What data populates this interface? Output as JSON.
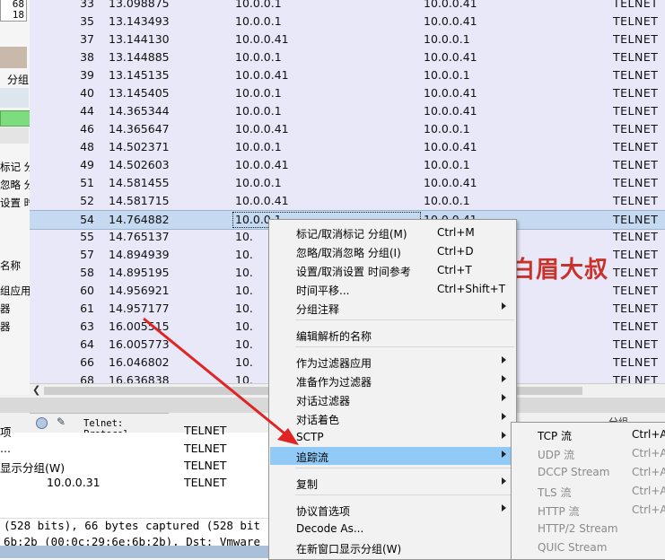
{
  "left_window": {
    "numbers": [
      "68",
      "18"
    ],
    "tab_label": "分组",
    "labels": [
      "标记 分",
      "忽略 分",
      "设置 时",
      "",
      "名称",
      "组应用",
      "器",
      "器"
    ]
  },
  "packets": [
    {
      "no": "33",
      "time": "13.098875",
      "src": "10.0.0.1",
      "dst": "10.0.0.41",
      "proto": "TELNET"
    },
    {
      "no": "35",
      "time": "13.143493",
      "src": "10.0.0.1",
      "dst": "10.0.0.41",
      "proto": "TELNET"
    },
    {
      "no": "37",
      "time": "13.144130",
      "src": "10.0.0.41",
      "dst": "10.0.0.1",
      "proto": "TELNET"
    },
    {
      "no": "38",
      "time": "13.144885",
      "src": "10.0.0.1",
      "dst": "10.0.0.41",
      "proto": "TELNET"
    },
    {
      "no": "39",
      "time": "13.145135",
      "src": "10.0.0.41",
      "dst": "10.0.0.1",
      "proto": "TELNET"
    },
    {
      "no": "40",
      "time": "13.145405",
      "src": "10.0.0.1",
      "dst": "10.0.0.41",
      "proto": "TELNET"
    },
    {
      "no": "44",
      "time": "14.365344",
      "src": "10.0.0.1",
      "dst": "10.0.0.41",
      "proto": "TELNET"
    },
    {
      "no": "46",
      "time": "14.365647",
      "src": "10.0.0.41",
      "dst": "10.0.0.1",
      "proto": "TELNET"
    },
    {
      "no": "48",
      "time": "14.502371",
      "src": "10.0.0.1",
      "dst": "10.0.0.41",
      "proto": "TELNET"
    },
    {
      "no": "49",
      "time": "14.502603",
      "src": "10.0.0.41",
      "dst": "10.0.0.1",
      "proto": "TELNET"
    },
    {
      "no": "51",
      "time": "14.581455",
      "src": "10.0.0.1",
      "dst": "10.0.0.41",
      "proto": "TELNET"
    },
    {
      "no": "52",
      "time": "14.581715",
      "src": "10.0.0.41",
      "dst": "10.0.0.1",
      "proto": "TELNET"
    },
    {
      "no": "54",
      "time": "14.764882",
      "src": "10.0.0.1",
      "dst": "10.0.0.41",
      "proto": "TELNET"
    },
    {
      "no": "55",
      "time": "14.765137",
      "src": "10.",
      "dst": "",
      "proto": "TELNET"
    },
    {
      "no": "57",
      "time": "14.894939",
      "src": "10.",
      "dst": "",
      "proto": "TELNET"
    },
    {
      "no": "58",
      "time": "14.895195",
      "src": "10.",
      "dst": "",
      "proto": "TELNET"
    },
    {
      "no": "60",
      "time": "14.956921",
      "src": "10.",
      "dst": "",
      "proto": "TELNET"
    },
    {
      "no": "61",
      "time": "14.957177",
      "src": "10.",
      "dst": "",
      "proto": "TELNET"
    },
    {
      "no": "63",
      "time": "16.005515",
      "src": "10.",
      "dst": "",
      "proto": "TELNET"
    },
    {
      "no": "64",
      "time": "16.005773",
      "src": "10.",
      "dst": "",
      "proto": "TELNET"
    },
    {
      "no": "66",
      "time": "16.046802",
      "src": "10.",
      "dst": "",
      "proto": "TELNET"
    },
    {
      "no": "68",
      "time": "16.636838",
      "src": "10.",
      "dst": "",
      "proto": "TELNET"
    }
  ],
  "status": {
    "protocol_text": "Telnet: Protocol",
    "right_text": "分组"
  },
  "lower_pane": {
    "items": [
      "TELNET",
      "TELNET",
      "TELNET",
      "TELNET"
    ],
    "left_texts": [
      "项",
      "...",
      "显示分组(W)"
    ],
    "address": "10.0.0.31"
  },
  "details": {
    "line1": "(528 bits), 66 bytes captured (528 bit",
    "line2": "6b:2b (00:0c:29:6e:6b:2b), Dst: Vmware"
  },
  "watermark": "白眉大叔",
  "context_menu": {
    "items": [
      {
        "label": "标记/取消标记 分组(M)",
        "shortcut": "Ctrl+M",
        "submenu": false
      },
      {
        "label": "忽略/取消忽略 分组(I)",
        "shortcut": "Ctrl+D",
        "submenu": false
      },
      {
        "label": "设置/取消设置 时间参考",
        "shortcut": "Ctrl+T",
        "submenu": false
      },
      {
        "label": "时间平移...",
        "shortcut": "Ctrl+Shift+T",
        "submenu": false
      },
      {
        "label": "分组注释",
        "shortcut": "",
        "submenu": true
      },
      {
        "label": "编辑解析的名称",
        "shortcut": "",
        "submenu": false
      },
      {
        "label": "作为过滤器应用",
        "shortcut": "",
        "submenu": true
      },
      {
        "label": "准备作为过滤器",
        "shortcut": "",
        "submenu": true
      },
      {
        "label": "对话过滤器",
        "shortcut": "",
        "submenu": true
      },
      {
        "label": "对话着色",
        "shortcut": "",
        "submenu": true
      },
      {
        "label": "SCTP",
        "shortcut": "",
        "submenu": true
      },
      {
        "label": "追踪流",
        "shortcut": "",
        "submenu": true
      },
      {
        "label": "复制",
        "shortcut": "",
        "submenu": true
      },
      {
        "label": "协议首选项",
        "shortcut": "",
        "submenu": true
      },
      {
        "label": "Decode As...",
        "shortcut": "",
        "submenu": false
      },
      {
        "label": "在新窗口显示分组(W)",
        "shortcut": "",
        "submenu": false
      }
    ],
    "highlighted": "追踪流"
  },
  "follow_submenu": {
    "items": [
      {
        "label": "TCP 流",
        "shortcut": "Ctrl+A",
        "enabled": true
      },
      {
        "label": "UDP 流",
        "shortcut": "Ctrl+A",
        "enabled": false
      },
      {
        "label": "DCCP Stream",
        "shortcut": "Ctrl+A",
        "enabled": false
      },
      {
        "label": "TLS 流",
        "shortcut": "Ctrl+A",
        "enabled": false
      },
      {
        "label": "HTTP 流",
        "shortcut": "Ctrl+A",
        "enabled": false
      },
      {
        "label": "HTTP/2 Stream",
        "shortcut": "",
        "enabled": false
      },
      {
        "label": "QUIC Stream",
        "shortcut": "",
        "enabled": false
      }
    ]
  },
  "colors": {
    "packet_row_bg": "#e8e8f8",
    "selected_row": "#c5d9f1",
    "menu_highlight": "#91c9f7",
    "arrow": "#e02424",
    "watermark": "#c8322a"
  }
}
